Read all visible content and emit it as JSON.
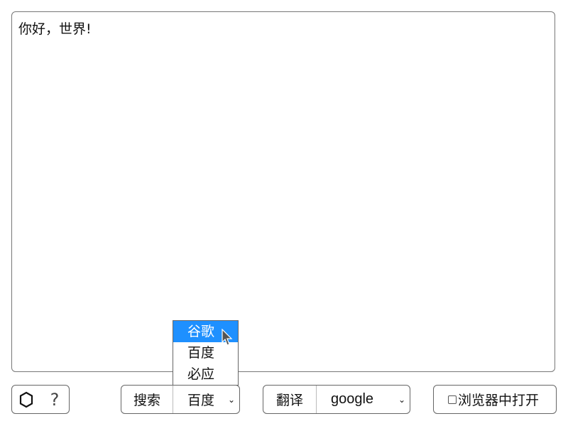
{
  "editor": {
    "text": "你好，世界!"
  },
  "toolbar": {
    "icons": [
      {
        "name": "hexagon-icon",
        "glyph": "⬡"
      },
      {
        "name": "help-icon",
        "glyph": "?"
      }
    ],
    "search": {
      "label": "搜索",
      "selected": "百度",
      "options": [
        "谷歌",
        "百度",
        "必应"
      ],
      "highlighted_option": "谷歌"
    },
    "translate": {
      "label": "翻译",
      "selected": "google"
    },
    "browser": {
      "label": "浏览器中打开",
      "checked": false
    }
  },
  "colors": {
    "highlight": "#1e90ff"
  }
}
